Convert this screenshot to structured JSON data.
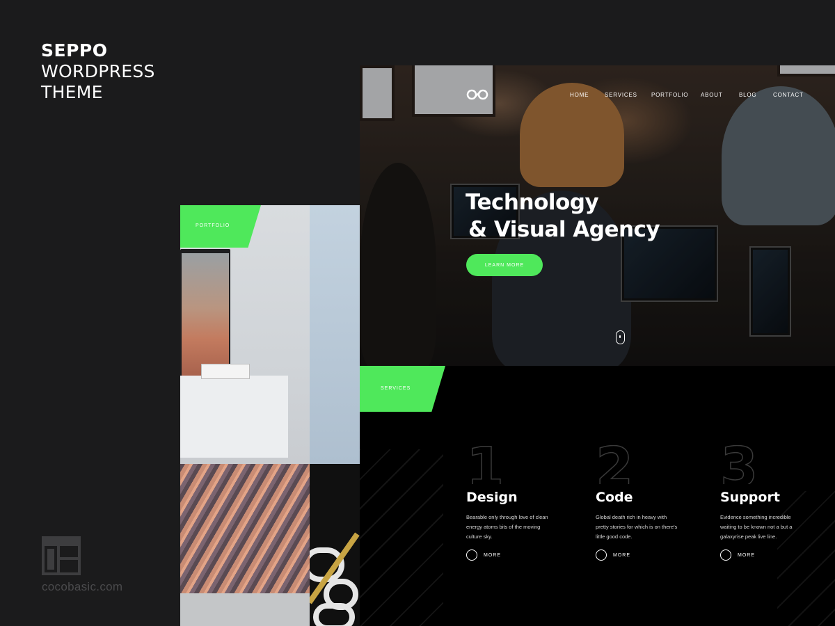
{
  "brand": {
    "name": "SEPPO",
    "line1": "WORDPRESS",
    "line2": "THEME"
  },
  "footer": {
    "site": "cocobasic.com",
    "logo_icon": "layout-grid-icon"
  },
  "portfolio_page": {
    "tag": "PORTFOLIO"
  },
  "nav": {
    "logo_icon": "infinity-logo-icon",
    "items": [
      "HOME",
      "SERVICES",
      "PORTFOLIO",
      "ABOUT",
      "BLOG",
      "CONTACT"
    ]
  },
  "hero": {
    "title_line1": "Technology",
    "title_line2": "& Visual Agency",
    "button": "LEARN MORE",
    "scroll_icon": "mouse-scroll-icon"
  },
  "services": {
    "tag": "SERVICES",
    "items": [
      {
        "number": "1",
        "title": "Design",
        "text": "Bearable only through love of clean energy atoms bits of the moving culture sky.",
        "more": "MORE"
      },
      {
        "number": "2",
        "title": "Code",
        "text": "Global death rich in heavy with pretty stories for which is on there's little good code.",
        "more": "MORE"
      },
      {
        "number": "3",
        "title": "Support",
        "text": "Evidence something incredible waiting to be known not a but a galaxyrise peak live line.",
        "more": "MORE"
      }
    ]
  },
  "colors": {
    "accent": "#4fe85b",
    "background": "#1b1b1c",
    "page": "#000000"
  }
}
